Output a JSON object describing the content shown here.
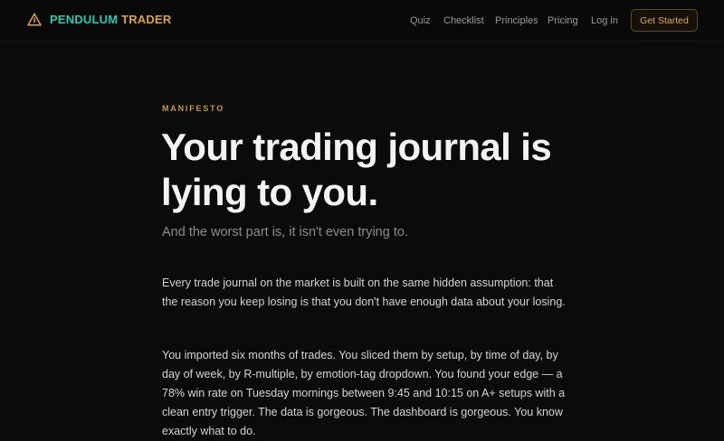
{
  "brand": {
    "name_part1": "PENDULUM",
    "name_part2": " TRADER",
    "icon": "triangle-icon",
    "colors": {
      "primary": "#2fc7b4",
      "secondary": "#d9a24a"
    }
  },
  "nav": {
    "items": [
      "Quiz",
      "Checklist",
      "Principles",
      "Pricing",
      "Log in"
    ],
    "cta": "Get Started"
  },
  "hero": {
    "eyebrow": "MANIFESTO",
    "headline": "Your trading journal is lying to you.",
    "subhead": "And the worst part is, it isn't even trying to."
  },
  "body": {
    "paragraphs": [
      "Every trade journal on the market is built on the same hidden assumption: that the reason you keep losing is that you don't have enough data about your losing.",
      "You imported six months of trades. You sliced them by setup, by time of day, by day of week, by R-multiple, by emotion-tag dropdown. You found your edge — a 78% win rate on Tuesday mornings between 9:45 and 10:15 on A+ setups with a clean entry trigger. The data is gorgeous. The dashboard is gorgeous. You know exactly what to do."
    ]
  },
  "theme": {
    "background": "#0b0b0b",
    "accent": "#d9a24a",
    "teal": "#2fc7b4"
  }
}
